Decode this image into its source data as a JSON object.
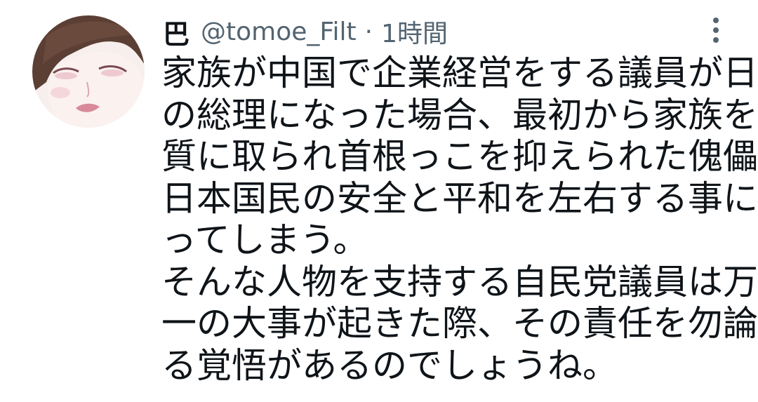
{
  "tweet": {
    "author": {
      "display_name": "巴",
      "handle": "@tomoe_Filt",
      "separator": "·",
      "timestamp": "1時間"
    },
    "menu_icon": "more-vertical-icon",
    "lines": [
      "家族が中国で企業経営をする議員が日本",
      "の総理になった場合、最初から家族を人",
      "質に取られ首根っこを抑えられた傀儡が",
      "日本国民の安全と平和を左右する事にな",
      "ってしまう。",
      "そんな人物を支持する自民党議員は万が",
      "一の大事が起きた際、その責任を勿論と",
      "る覚悟があるのでしょうね。"
    ]
  }
}
